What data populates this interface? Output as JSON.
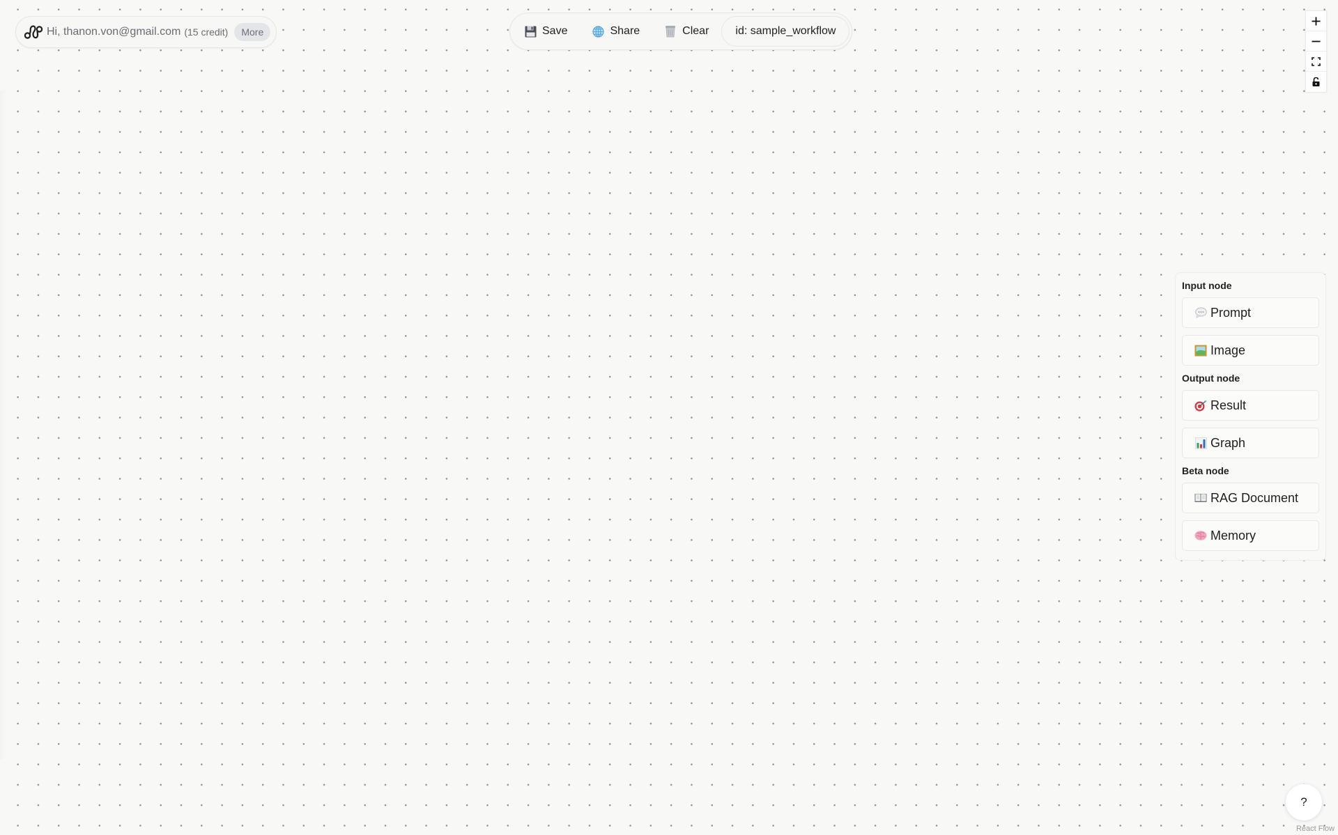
{
  "user": {
    "greeting": "Hi, thanon.von@gmail.com",
    "credit": "(15 credit)",
    "more_label": "More",
    "logo_icon": "link-chain-logo"
  },
  "toolbar": {
    "save_label": "Save",
    "save_icon": "floppy-disk-icon",
    "share_label": "Share",
    "share_icon": "globe-icon",
    "clear_label": "Clear",
    "clear_icon": "trash-can-icon",
    "workflow_id": "id: sample_workflow"
  },
  "controls": [
    {
      "name": "zoom-in",
      "icon": "plus-icon"
    },
    {
      "name": "zoom-out",
      "icon": "minus-icon"
    },
    {
      "name": "fit-view",
      "icon": "fit-view-icon"
    },
    {
      "name": "toggle-interactivity",
      "icon": "unlock-icon"
    }
  ],
  "node_panel": {
    "sections": [
      {
        "title": "Input node",
        "items": [
          {
            "label": "Prompt",
            "icon": "speech-bubble-icon"
          },
          {
            "label": "Image",
            "icon": "framed-picture-icon"
          }
        ]
      },
      {
        "title": "Output node",
        "items": [
          {
            "label": "Result",
            "icon": "target-icon"
          },
          {
            "label": "Graph",
            "icon": "bar-chart-icon"
          }
        ]
      },
      {
        "title": "Beta node",
        "items": [
          {
            "label": "RAG Document",
            "icon": "open-book-icon"
          },
          {
            "label": "Memory",
            "icon": "brain-icon"
          }
        ]
      }
    ]
  },
  "help": {
    "label": "?"
  },
  "attribution": "React Flow",
  "colors": {
    "canvas_bg": "#f8f8f7",
    "dot": "#8f8f8f",
    "more_bg": "#e3e5e9",
    "text_muted": "#6b6b70"
  }
}
